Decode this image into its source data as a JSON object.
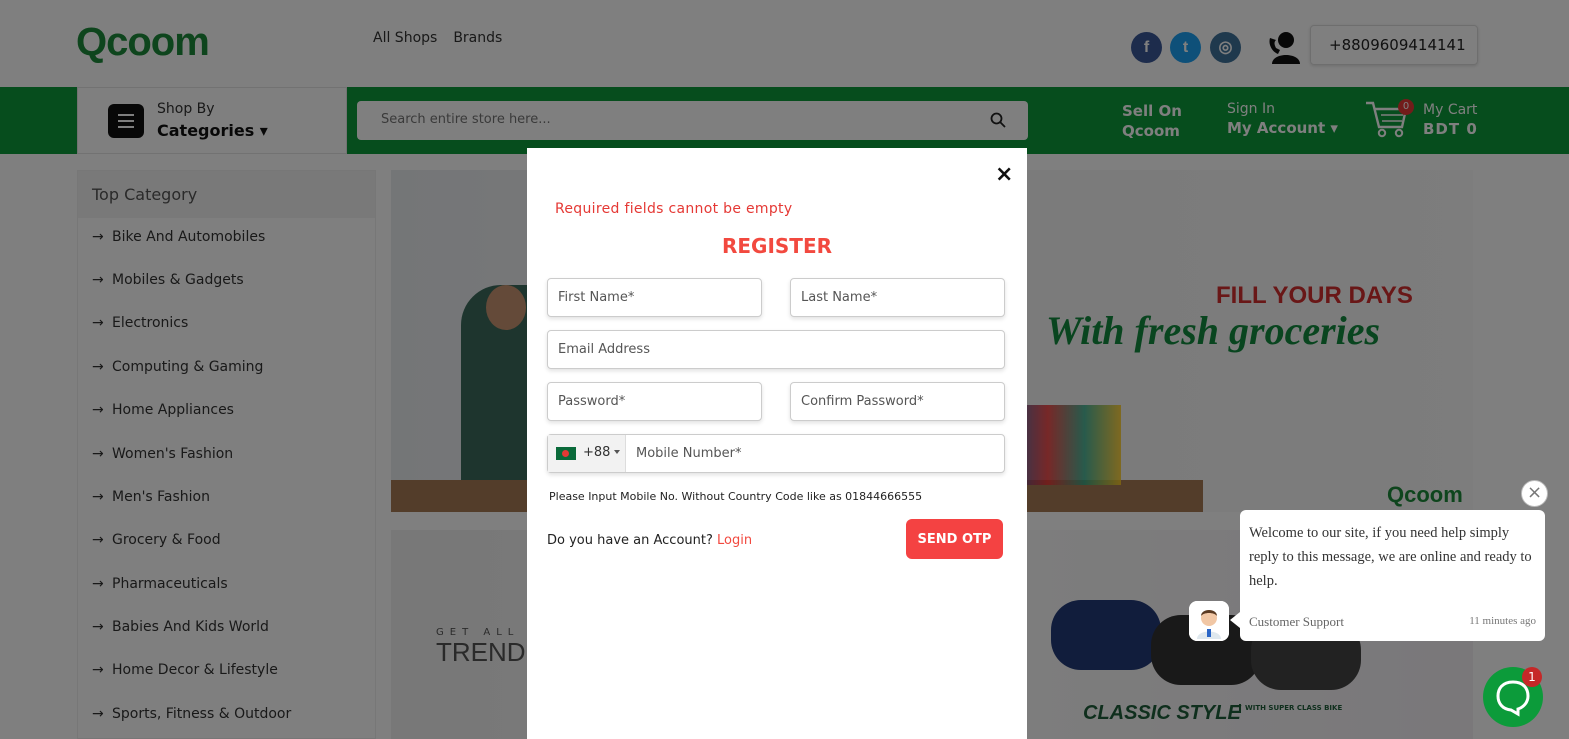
{
  "header": {
    "logo_text": "Qcoom",
    "nav": [
      "All Shops",
      "Brands"
    ],
    "social": [
      "facebook-icon",
      "twitter-icon",
      "instagram-icon"
    ],
    "phone": "+8809609414141"
  },
  "greenbar": {
    "shop_by": "Shop By",
    "categories": "Categories ▾",
    "search_placeholder": "Search entire store here...",
    "sell_line1": "Sell On",
    "sell_line2": "Qcoom",
    "signin": "Sign In",
    "my_account": "My Account ▾",
    "cart_count": "0",
    "cart_label": "My Cart",
    "cart_total": "BDT 0"
  },
  "sidebar": {
    "title": "Top Category",
    "items": [
      "Bike And Automobiles",
      "Mobiles & Gadgets",
      "Electronics",
      "Computing & Gaming",
      "Home Appliances",
      "Women's Fashion",
      "Men's Fashion",
      "Grocery & Food",
      "Pharmaceuticals",
      "Babies And Kids World",
      "Home Decor & Lifestyle",
      "Sports, Fitness & Outdoor"
    ]
  },
  "banners": {
    "fill_your_days": "FILL YOUR DAYS",
    "fresh": "With fresh groceries",
    "banner_logo": "Qcoom",
    "get_all": "GET ALL",
    "trendi": "TRENDI",
    "classic": "CLASSIC STYLE",
    "with_super": "WITH SUPER CLASS BIKE"
  },
  "modal": {
    "close": "×",
    "error": "Required fields cannot be empty",
    "title": "REGISTER",
    "first_name_ph": "First Name*",
    "last_name_ph": "Last Name*",
    "email_ph": "Email Address",
    "password_ph": "Password*",
    "confirm_ph": "Confirm Password*",
    "country_code": "+88",
    "mobile_ph": "Mobile Number*",
    "hint": "Please Input Mobile No. Without Country Code like as 01844666555",
    "have_account": "Do you have an Account?",
    "login": "Login",
    "send_otp": "SEND OTP"
  },
  "chat": {
    "close": "×",
    "message": "Welcome to our site, if you need help simply reply to this message, we are online and ready to help.",
    "agent": "Customer Support",
    "time": "11 minutes ago",
    "badge": "1"
  },
  "colors": {
    "brand_green": "#0c9b3a",
    "accent_red": "#f2493f"
  }
}
